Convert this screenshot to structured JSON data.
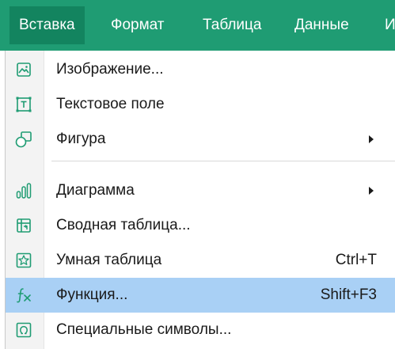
{
  "menubar": {
    "items": [
      "Вставка",
      "Формат",
      "Таблица",
      "Данные",
      "И"
    ],
    "active_index": 0
  },
  "menu": {
    "items": [
      {
        "label": "Изображение...",
        "icon": "image-icon",
        "shortcut": "",
        "submenu": false
      },
      {
        "label": "Текстовое поле",
        "icon": "text-box-icon",
        "shortcut": "",
        "submenu": false
      },
      {
        "label": "Фигура",
        "icon": "shape-icon",
        "shortcut": "",
        "submenu": true
      },
      {
        "label": "Диаграмма",
        "icon": "chart-icon",
        "shortcut": "",
        "submenu": true
      },
      {
        "label": "Сводная таблица...",
        "icon": "pivot-table-icon",
        "shortcut": "",
        "submenu": false
      },
      {
        "label": "Умная таблица",
        "icon": "smart-table-icon",
        "shortcut": "Ctrl+T",
        "submenu": false
      },
      {
        "label": "Функция...",
        "icon": "function-icon",
        "shortcut": "Shift+F3",
        "submenu": false,
        "highlighted": true
      },
      {
        "label": "Специальные символы...",
        "icon": "special-symbols-icon",
        "shortcut": "",
        "submenu": false
      }
    ]
  },
  "colors": {
    "menubar_bg": "#1f9c73",
    "active_tab_bg": "#13845f",
    "highlight_bg": "#a9d0f5",
    "icon_color": "#1f9c73"
  }
}
